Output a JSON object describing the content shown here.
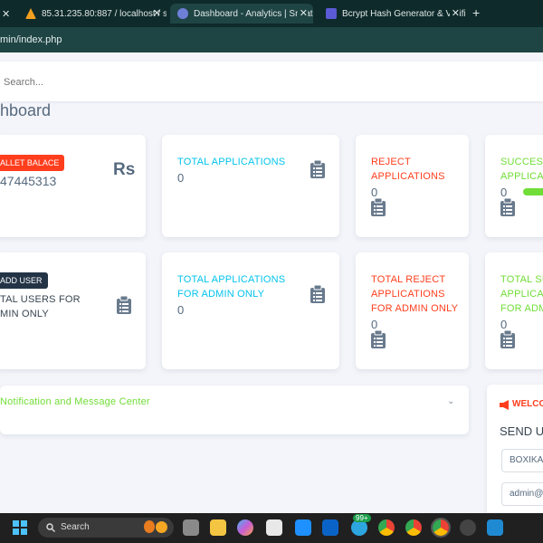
{
  "browser": {
    "tabs": [
      {
        "label": "85.31.235.80:887 / localhost / s"
      },
      {
        "label": "Dashboard - Analytics | Sneat -"
      },
      {
        "label": "Bcrypt Hash Generator & Verifi"
      }
    ],
    "new_tab": "+",
    "close": "✕",
    "url": "min/index.php"
  },
  "search": {
    "placeholder": "Search..."
  },
  "page_title": "hboard",
  "cards_row1": {
    "wallet": {
      "badge": "ALLET BALACE",
      "value": "47445313",
      "currency": "Rs"
    },
    "total_applications": {
      "label": "TOTAL APPLICATIONS",
      "value": "0"
    },
    "reject_applications": {
      "label_1": "REJECT",
      "label_2": "APPLICATIONS",
      "value": "0"
    },
    "success_applications": {
      "label_1": "SUCCESS",
      "label_2": "APPLICATI",
      "value": "0"
    }
  },
  "cards_row2": {
    "add_user": {
      "badge": "ADD USER",
      "label_1": "TAL USERS FOR",
      "label_2": "MIN ONLY"
    },
    "total_admin": {
      "label_1": "TOTAL APPLICATIONS",
      "label_2": "FOR ADMIN ONLY",
      "value": "0"
    },
    "reject_admin": {
      "label_1": "TOTAL REJECT",
      "label_2": "APPLICATIONS",
      "label_3": "FOR ADMIN ONLY",
      "value": "0"
    },
    "success_admin": {
      "label_1": "TOTAL SU",
      "label_2": "APPLICAT",
      "label_3": "FOR ADM",
      "value": "0"
    }
  },
  "notification": {
    "title": "Notification and Message Center",
    "chevron": "⌄"
  },
  "right_panel": {
    "welcome": "WELCO",
    "send": "SEND U",
    "input_1": "BOXIKA",
    "input_2": "admin@"
  },
  "taskbar": {
    "search_label": "Search",
    "badge": "99+"
  },
  "colors": {
    "cyan": "#03c3ec",
    "red": "#ff3e1d",
    "green": "#71dd37",
    "dark_badge": "#233446"
  }
}
